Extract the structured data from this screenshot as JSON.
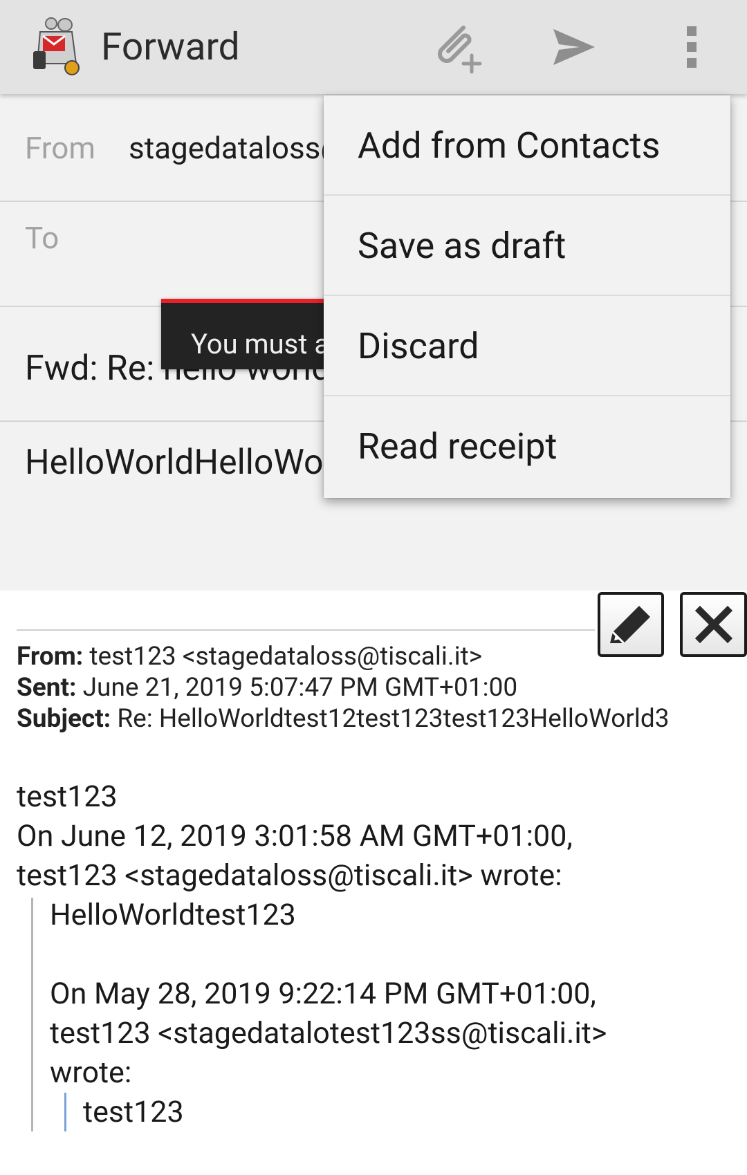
{
  "app_bar": {
    "title": "Forward",
    "attach_icon": "attach-add-icon",
    "send_icon": "send-icon",
    "overflow_icon": "more-vert-icon"
  },
  "compose": {
    "from_label": "From",
    "from_value": "stagedataloss@tiscali.it",
    "to_label": "To",
    "subject": "Fwd: Re: hello world",
    "body": "HelloWorldHelloWorld"
  },
  "toast": {
    "text": "You must add a recipient."
  },
  "overflow_menu": {
    "items": [
      {
        "label": "Add from Contacts"
      },
      {
        "label": "Save as draft"
      },
      {
        "label": "Discard"
      },
      {
        "label": "Read receipt"
      }
    ]
  },
  "quoted": {
    "edit_icon": "pencil-icon",
    "remove_icon": "close-icon",
    "header": {
      "from_label": "From:",
      "from_value": "test123 <stagedataloss@tiscali.it>",
      "sent_label": "Sent:",
      "sent_value": "June 21, 2019 5:07:47 PM GMT+01:00",
      "subject_label": "Subject:",
      "subject_value": "Re: HelloWorldtest12test123test123HelloWorld3"
    },
    "body_lines": [
      "test123",
      "On June 12, 2019 3:01:58 AM GMT+01:00,",
      "test123 <stagedataloss@tiscali.it> wrote:"
    ],
    "quote_level1": [
      "HelloWorldtest123",
      "On May 28, 2019 9:22:14 PM GMT+01:00,",
      "test123 <stagedatalotest123ss@tiscali.it>",
      "wrote:"
    ],
    "quote_level2": [
      "test123"
    ]
  },
  "colors": {
    "app_bar": "#e3e3e3",
    "toast_accent": "#e8202a",
    "quote_bar_nested": "#7aa0d8"
  }
}
